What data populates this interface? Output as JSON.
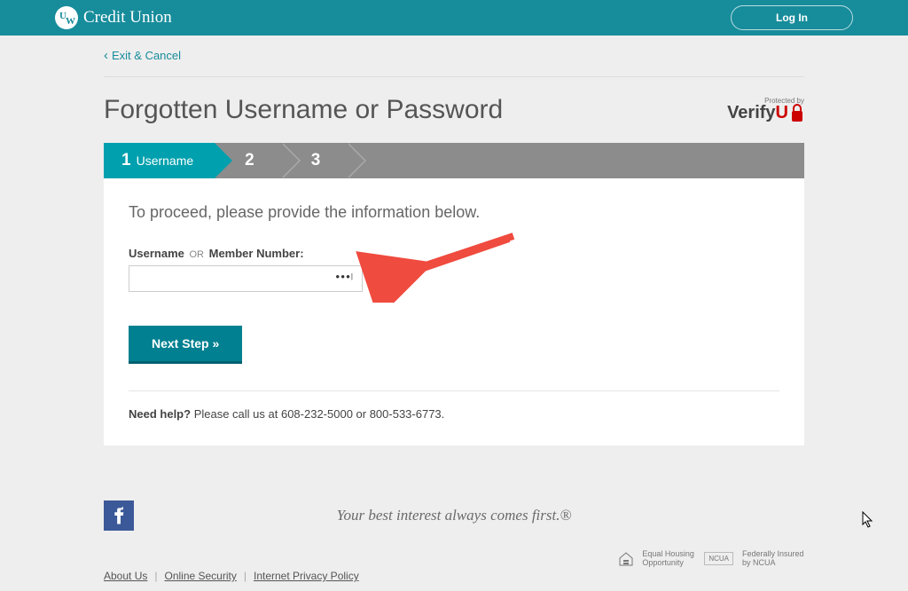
{
  "header": {
    "brand_name": "Credit Union",
    "login_label": "Log In"
  },
  "nav": {
    "exit_label": "Exit & Cancel"
  },
  "page": {
    "title": "Forgotten Username or Password",
    "verify_protected": "Protected by",
    "verify_brand": "Verify",
    "verify_suffix": "U"
  },
  "stepper": {
    "steps": [
      {
        "num": "1",
        "label": "Username"
      },
      {
        "num": "2",
        "label": ""
      },
      {
        "num": "3",
        "label": ""
      }
    ]
  },
  "form": {
    "instruction": "To proceed, please provide the information below.",
    "label_part1": "Username",
    "label_or": "OR",
    "label_part2": "Member Number:",
    "input_value": "",
    "next_label": "Next Step »"
  },
  "help": {
    "bold": "Need help?",
    "text": " Please call us at 608-232-5000 or 800-533-6773."
  },
  "footer": {
    "tagline": "Your best interest always comes first.®",
    "links": {
      "about": "About Us",
      "security": "Online Security",
      "privacy": "Internet Privacy Policy"
    },
    "badges": {
      "ehl": "Equal Housing Opportunity",
      "ncua_box": "NCUA",
      "ncua": "Federally Insured by NCUA"
    }
  }
}
